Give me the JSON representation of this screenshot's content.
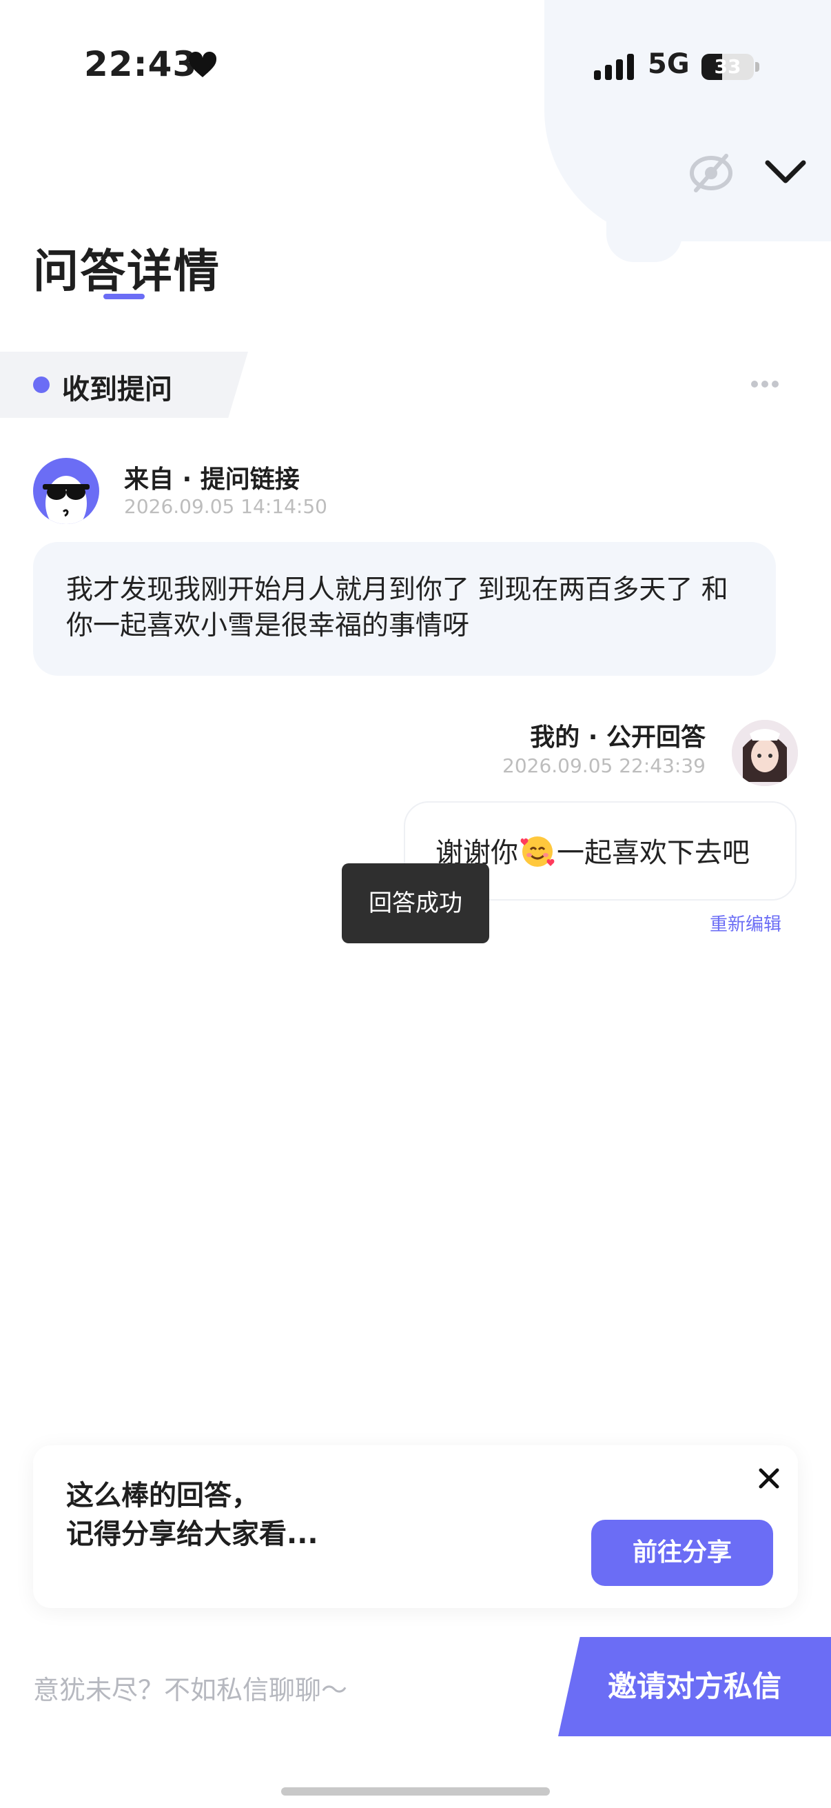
{
  "status_bar": {
    "time": "22:43",
    "network": "5G",
    "battery": "33",
    "icons": [
      "heart-icon",
      "signal-icon",
      "battery-icon"
    ]
  },
  "header": {
    "title": "问答详情",
    "icons": [
      "eye-off-icon",
      "chevron-down-icon"
    ]
  },
  "section": {
    "label": "收到提问",
    "accent": "#6b6df5"
  },
  "question": {
    "from": "来自 · 提问链接",
    "timestamp": "2026.09.05 14:14:50",
    "text": "我才发现我刚开始月人就月到你了 到现在两百多天了 和你一起喜欢小雪是很幸福的事情呀"
  },
  "answer": {
    "author": "我的 · 公开回答",
    "timestamp": "2026.09.05 22:43:39",
    "text_before": "谢谢你",
    "emoji": "smiling-face-with-hearts-icon",
    "text_after": "一起喜欢下去吧",
    "reedit_label": "重新编辑"
  },
  "toast": {
    "text": "回答成功"
  },
  "share_card": {
    "line1": "这么棒的回答，",
    "line2": "记得分享给大家看...",
    "button_label": "前往分享"
  },
  "bottom_bar": {
    "placeholder": "意犹未尽？不如私信聊聊～",
    "invite_label": "邀请对方私信"
  },
  "colors": {
    "accent": "#6b6df5",
    "bubble_bg": "#f3f6fb",
    "toast_bg": "#2f2f2f"
  }
}
